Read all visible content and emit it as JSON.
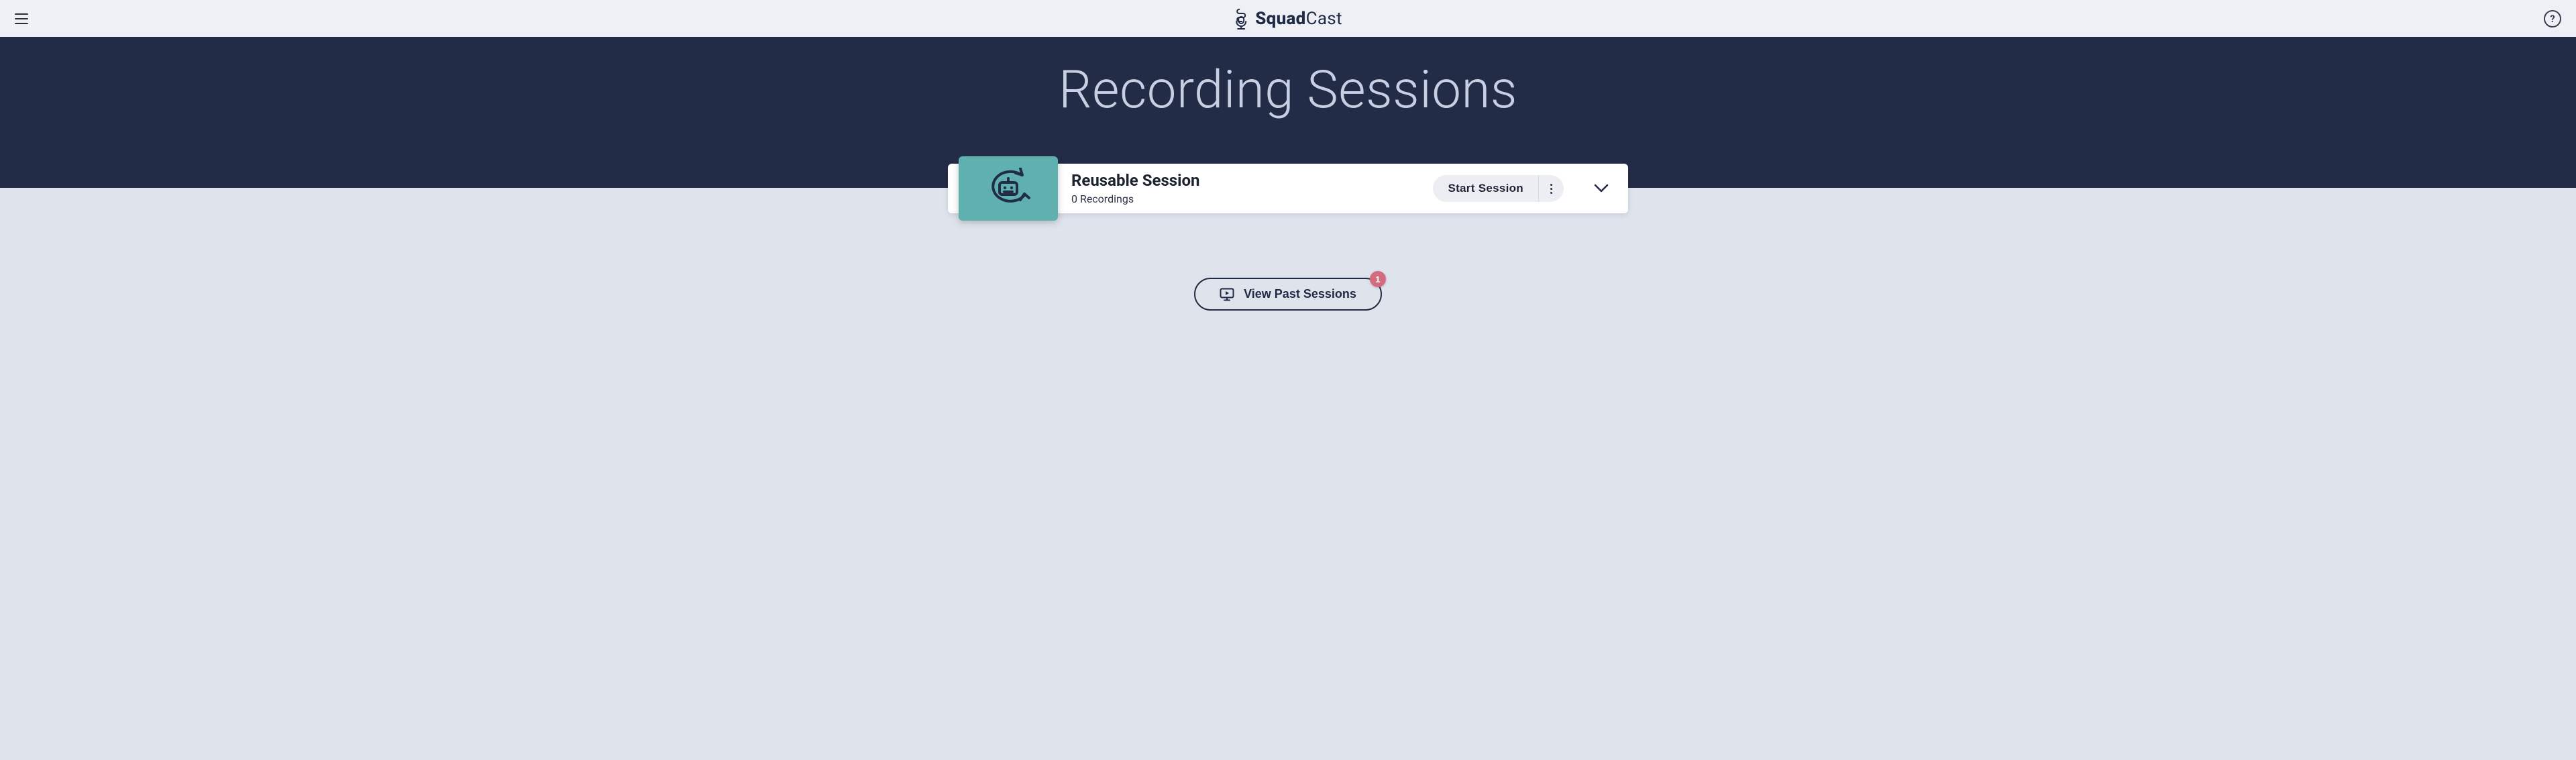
{
  "brand": {
    "part1": "Squad",
    "part2": "Cast"
  },
  "help_glyph": "?",
  "hero": {
    "title": "Recording Sessions"
  },
  "session": {
    "title": "Reusable Session",
    "subtitle": "0 Recordings",
    "start_label": "Start Session"
  },
  "past": {
    "label": "View Past Sessions",
    "badge": "1"
  }
}
